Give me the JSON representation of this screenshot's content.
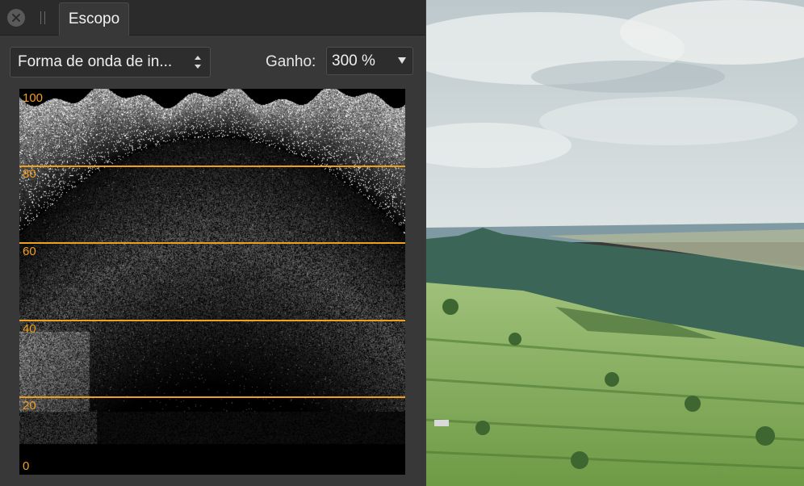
{
  "window": {
    "tab_label": "Escopo"
  },
  "controls": {
    "mode_select": "Forma de onda de in...",
    "gain_label": "Ganho:",
    "gain_value": "300 %"
  },
  "scope": {
    "ticks": [
      "100",
      "80",
      "60",
      "40",
      "20",
      "0"
    ],
    "guide_levels": [
      80,
      60,
      40,
      20
    ],
    "guide_color": "#f0a020"
  },
  "icons": {
    "close": "close-icon",
    "grip": "drag-handle-icon",
    "updown": "chevron-updown-icon",
    "caret": "chevron-down-icon"
  }
}
